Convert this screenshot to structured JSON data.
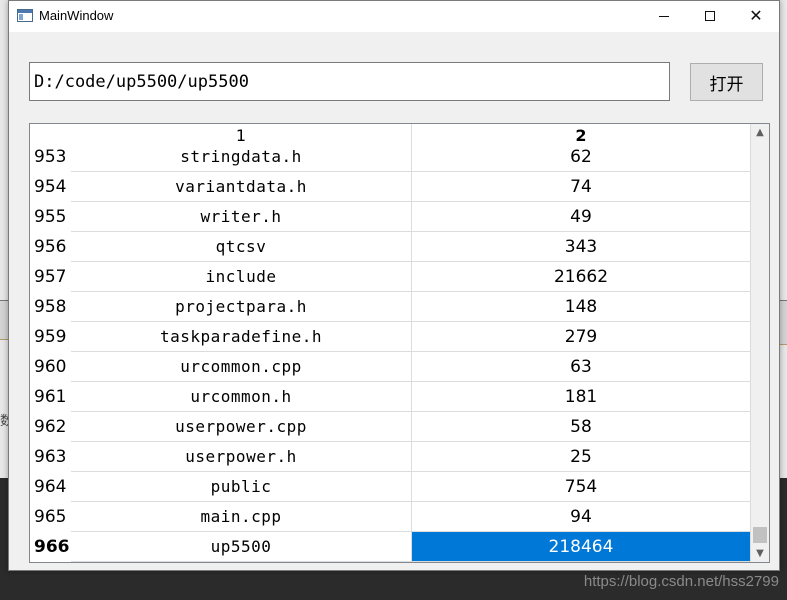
{
  "window": {
    "title": "MainWindow",
    "controls": {
      "minimize_icon": "minimize-icon",
      "maximize_icon": "maximize-icon",
      "close_icon": "close-icon"
    }
  },
  "path_field": {
    "value": "D:/code/up5500/up5500"
  },
  "open_button": {
    "label": "打开"
  },
  "table": {
    "column_headers": [
      "1",
      "2"
    ],
    "rows": [
      {
        "num": "953",
        "name": "stringdata.h",
        "count": "62"
      },
      {
        "num": "954",
        "name": "variantdata.h",
        "count": "74"
      },
      {
        "num": "955",
        "name": "writer.h",
        "count": "49"
      },
      {
        "num": "956",
        "name": "qtcsv",
        "count": "343"
      },
      {
        "num": "957",
        "name": "include",
        "count": "21662"
      },
      {
        "num": "958",
        "name": "projectpara.h",
        "count": "148"
      },
      {
        "num": "959",
        "name": "taskparadefine.h",
        "count": "279"
      },
      {
        "num": "960",
        "name": "urcommon.cpp",
        "count": "63"
      },
      {
        "num": "961",
        "name": "urcommon.h",
        "count": "181"
      },
      {
        "num": "962",
        "name": "userpower.cpp",
        "count": "58"
      },
      {
        "num": "963",
        "name": "userpower.h",
        "count": "25"
      },
      {
        "num": "964",
        "name": "public",
        "count": "754"
      },
      {
        "num": "965",
        "name": "main.cpp",
        "count": "94"
      },
      {
        "num": "966",
        "name": "up5500",
        "count": "218464"
      }
    ],
    "current_row_index": 13,
    "selected_color": "#0078d7"
  },
  "watermark": "https://blog.csdn.net/hss2799"
}
